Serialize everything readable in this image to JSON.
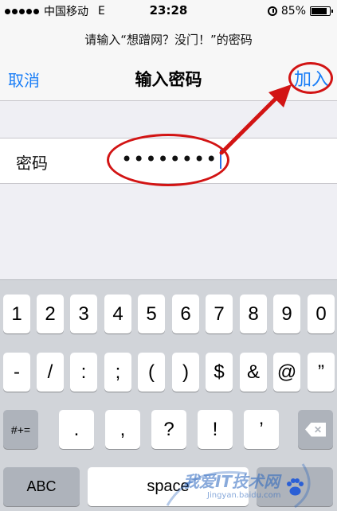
{
  "status_bar": {
    "carrier": "中国移动",
    "network": "E",
    "time": "23:28",
    "battery": "85%",
    "battery_level": 0.85,
    "icons": [
      "signal-dots-icon",
      "alarm-icon",
      "battery-icon"
    ]
  },
  "prompt": {
    "text": "请输入“想蹭网？没门！”的密码"
  },
  "nav": {
    "cancel_label": "取消",
    "title": "输入密码",
    "join_label": "加入"
  },
  "password_field": {
    "label": "密码",
    "value": "••••••••"
  },
  "keyboard": {
    "row1": [
      "1",
      "2",
      "3",
      "4",
      "5",
      "6",
      "7",
      "8",
      "9",
      "0"
    ],
    "row2": [
      "-",
      "/",
      ":",
      ";",
      "(",
      ")",
      "$",
      "&",
      "@",
      "”"
    ],
    "row3_left": "#+=",
    "row3_mid": [
      ".",
      ",",
      "?",
      "!",
      "’"
    ],
    "row3_right_icon": "backspace-icon",
    "abc_label": "ABC",
    "space_label": "space",
    "accent_key_icon": "baidu-paw-icon"
  },
  "annotations": {
    "ring_color": "#d21414",
    "arrow_color": "#d21414"
  },
  "watermark": {
    "text": "我爱IT技术网",
    "url": "Jingyan.baidu.com"
  },
  "colors": {
    "accent": "#1a7ef7",
    "keyboard_bg": "#d1d4d9"
  }
}
